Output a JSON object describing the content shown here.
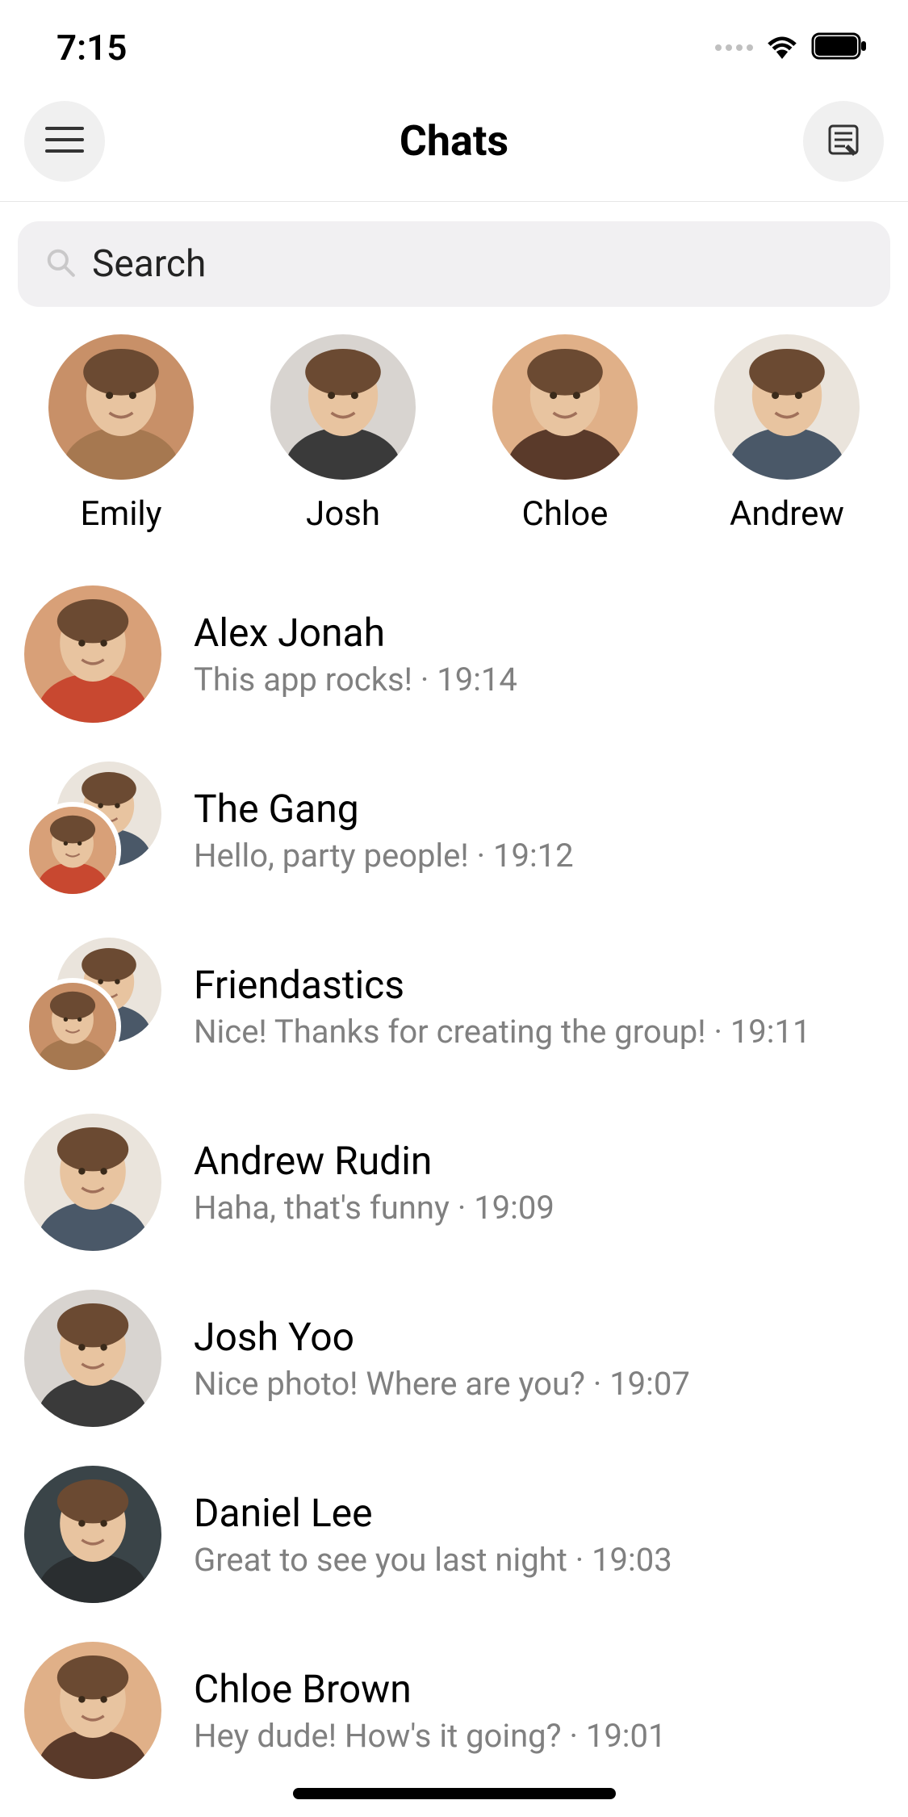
{
  "status": {
    "time": "7:15"
  },
  "header": {
    "title": "Chats"
  },
  "search": {
    "placeholder": "Search"
  },
  "stories": [
    {
      "name": "Emily",
      "bg1": "#c89068",
      "bg2": "#a67850"
    },
    {
      "name": "Josh",
      "bg1": "#d8d4d0",
      "bg2": "#3a3a3a"
    },
    {
      "name": "Chloe",
      "bg1": "#e0b088",
      "bg2": "#5a3a2a"
    },
    {
      "name": "Andrew",
      "bg1": "#eae4dc",
      "bg2": "#4a5868"
    }
  ],
  "chats": [
    {
      "name": "Alex Jonah",
      "preview": "This app rocks!",
      "time": "19:14",
      "group": false,
      "bg1": "#d8a078",
      "bg2": "#c84830"
    },
    {
      "name": "The Gang",
      "preview": "Hello, party people!",
      "time": "19:12",
      "group": true,
      "bg1a": "#eae4dc",
      "bg2a": "#4a5868",
      "bg1b": "#d8a078",
      "bg2b": "#c84830"
    },
    {
      "name": "Friendastics",
      "preview": "Nice! Thanks for creating the group!",
      "time": "19:11",
      "group": true,
      "bg1a": "#eae4dc",
      "bg2a": "#4a5868",
      "bg1b": "#c89068",
      "bg2b": "#a67850"
    },
    {
      "name": "Andrew Rudin",
      "preview": "Haha, that's funny",
      "time": "19:09",
      "group": false,
      "bg1": "#eae4dc",
      "bg2": "#4a5868"
    },
    {
      "name": "Josh Yoo",
      "preview": "Nice photo! Where are you?",
      "time": "19:07",
      "group": false,
      "bg1": "#d8d4d0",
      "bg2": "#3a3a3a"
    },
    {
      "name": "Daniel Lee",
      "preview": "Great to see you last night",
      "time": "19:03",
      "group": false,
      "bg1": "#3a4448",
      "bg2": "#2a2e30"
    },
    {
      "name": "Chloe Brown",
      "preview": "Hey dude! How's it going?",
      "time": "19:01",
      "group": false,
      "bg1": "#e0b088",
      "bg2": "#5a3a2a"
    }
  ]
}
